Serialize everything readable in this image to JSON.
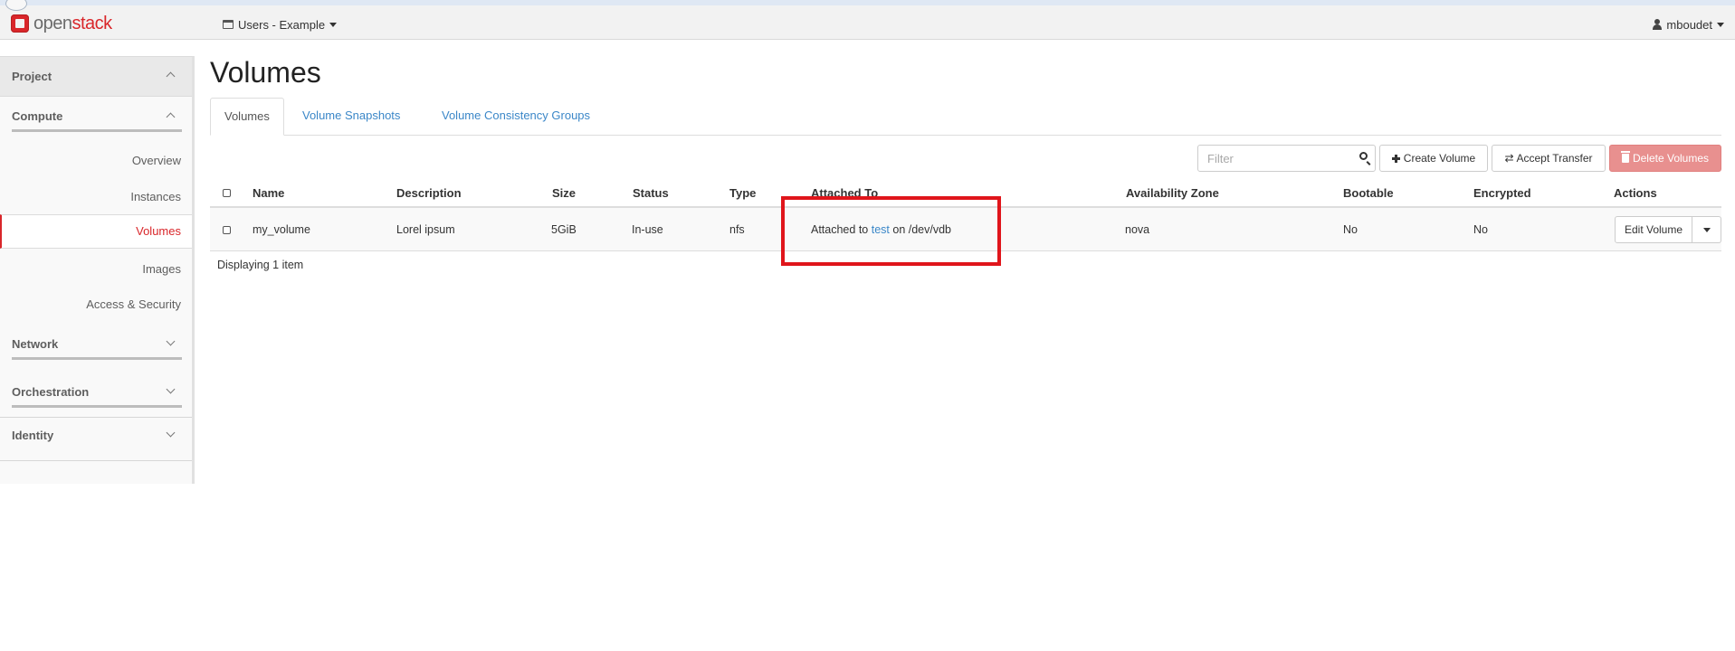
{
  "brand": {
    "open": "open",
    "stack": "stack"
  },
  "topbar": {
    "project_label": "Users - Example",
    "user_label": "mboudet"
  },
  "sidebar": {
    "project": "Project",
    "compute": "Compute",
    "compute_items": [
      "Overview",
      "Instances",
      "Volumes",
      "Images",
      "Access & Security"
    ],
    "network": "Network",
    "orchestration": "Orchestration",
    "identity": "Identity"
  },
  "page": {
    "title": "Volumes"
  },
  "tabs": [
    "Volumes",
    "Volume Snapshots",
    "Volume Consistency Groups"
  ],
  "toolbar": {
    "filter_placeholder": "Filter",
    "create": "Create Volume",
    "accept": "Accept Transfer",
    "delete": "Delete Volumes"
  },
  "table": {
    "headers": [
      "Name",
      "Description",
      "Size",
      "Status",
      "Type",
      "Attached To",
      "Availability Zone",
      "Bootable",
      "Encrypted",
      "Actions"
    ],
    "rows": [
      {
        "name": "my_volume",
        "description": "Lorel ipsum",
        "size": "5GiB",
        "status": "In-use",
        "type": "nfs",
        "attached_prefix": "Attached to",
        "attached_instance": "test",
        "attached_suffix": "on /dev/vdb",
        "zone": "nova",
        "bootable": "No",
        "encrypted": "No",
        "action": "Edit Volume"
      }
    ],
    "footer": "Displaying 1 item"
  },
  "colors": {
    "brand_red": "#d9262a",
    "link_blue": "#3b87c8",
    "highlight": "#e0151b",
    "danger_button": "#e8908f"
  },
  "icons": [
    "openstack-logo-icon",
    "project-icon",
    "user-icon",
    "search-icon",
    "plus-icon",
    "swap-icon",
    "trash-icon",
    "caret-down-icon",
    "chevron-up-icon",
    "chevron-down-icon"
  ]
}
